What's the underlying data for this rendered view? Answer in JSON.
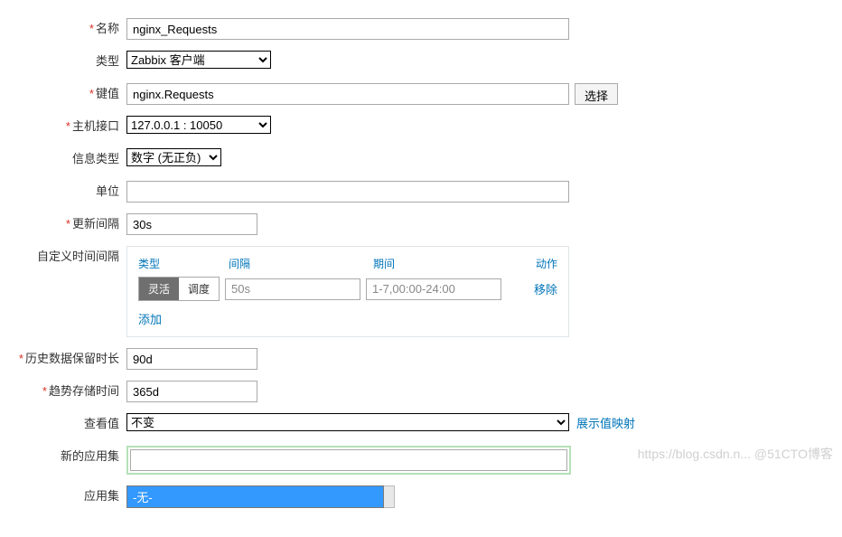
{
  "labels": {
    "name": "名称",
    "type": "类型",
    "key": "键值",
    "host_interface": "主机接口",
    "info_type": "信息类型",
    "unit": "单位",
    "update_interval": "更新间隔",
    "custom_interval": "自定义时间间隔",
    "history": "历史数据保留时长",
    "trend": "趋势存储时间",
    "show_value": "查看值",
    "new_app": "新的应用集",
    "app": "应用集"
  },
  "values": {
    "name": "nginx_Requests",
    "type": "Zabbix 客户端",
    "key": "nginx.Requests",
    "host_interface": "127.0.0.1 : 10050",
    "info_type": "数字 (无正负)",
    "unit": "",
    "update_interval": "30s",
    "history": "90d",
    "trend": "365d",
    "show_value": "不变",
    "new_app": "",
    "app_option": "-无-"
  },
  "buttons": {
    "select": "选择",
    "show_map": "展示值映射",
    "add": "添加",
    "remove": "移除"
  },
  "custom": {
    "col_type": "类型",
    "col_interval": "间隔",
    "col_period": "期间",
    "col_action": "动作",
    "seg_flex": "灵活",
    "seg_sched": "调度",
    "interval_val": "50s",
    "period_val": "1-7,00:00-24:00"
  },
  "watermark": "https://blog.csdn.n... @51CTO博客"
}
